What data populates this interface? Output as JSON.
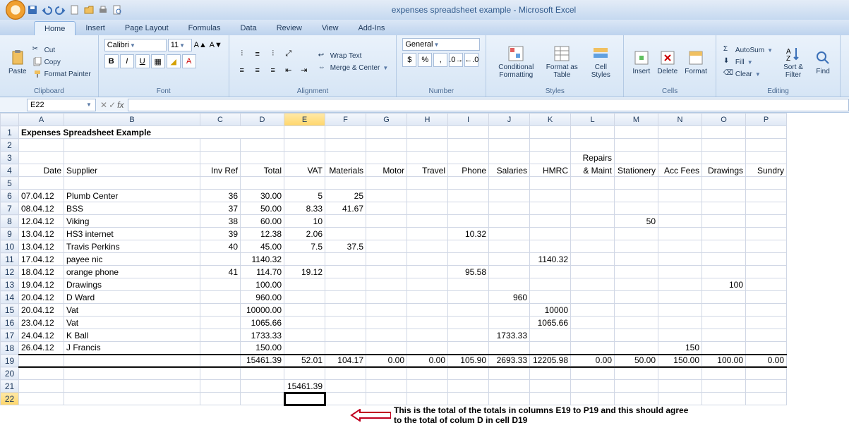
{
  "window": {
    "title": "expenses spreadsheet example - Microsoft Excel"
  },
  "tabs": [
    "Home",
    "Insert",
    "Page Layout",
    "Formulas",
    "Data",
    "Review",
    "View",
    "Add-Ins"
  ],
  "active_tab": 0,
  "ribbon": {
    "clipboard": {
      "paste": "Paste",
      "cut": "Cut",
      "copy": "Copy",
      "fp": "Format Painter",
      "label": "Clipboard"
    },
    "font": {
      "name": "Calibri",
      "size": "11",
      "label": "Font"
    },
    "alignment": {
      "wrap": "Wrap Text",
      "merge": "Merge & Center",
      "label": "Alignment"
    },
    "number": {
      "format": "General",
      "label": "Number"
    },
    "styles": {
      "cond": "Conditional Formatting",
      "fat": "Format as Table",
      "cs": "Cell Styles",
      "label": "Styles"
    },
    "cells": {
      "ins": "Insert",
      "del": "Delete",
      "fmt": "Format",
      "label": "Cells"
    },
    "editing": {
      "autosum": "AutoSum",
      "fill": "Fill",
      "clear": "Clear",
      "sort": "Sort & Filter",
      "find": "Find",
      "label": "Editing"
    }
  },
  "name_box": "E22",
  "cols": [
    "A",
    "B",
    "C",
    "D",
    "E",
    "F",
    "G",
    "H",
    "I",
    "J",
    "K",
    "L",
    "M",
    "N",
    "O",
    "P"
  ],
  "widths": [
    64,
    193,
    57,
    62,
    58,
    58,
    58,
    58,
    58,
    58,
    58,
    62,
    62,
    62,
    62,
    58
  ],
  "sheet": {
    "title": "Expenses Spreadsheet Example",
    "headers_r3": {
      "L": "Repairs"
    },
    "headers_r4": [
      "Date",
      "Supplier",
      "Inv Ref",
      "Total",
      "VAT",
      "Materials",
      "Motor",
      "Travel",
      "Phone",
      "Salaries",
      "HMRC",
      "& Maint",
      "Stationery",
      "Acc Fees",
      "Drawings",
      "Sundry"
    ],
    "rows": [
      {
        "n": 6,
        "d": [
          "07.04.12",
          "Plumb Center",
          "36",
          "30.00",
          "5",
          "25",
          "",
          "",
          "",
          "",
          "",
          "",
          "",
          "",
          "",
          ""
        ]
      },
      {
        "n": 7,
        "d": [
          "08.04.12",
          "BSS",
          "37",
          "50.00",
          "8.33",
          "41.67",
          "",
          "",
          "",
          "",
          "",
          "",
          "",
          "",
          "",
          ""
        ]
      },
      {
        "n": 8,
        "d": [
          "12.04.12",
          "Viking",
          "38",
          "60.00",
          "10",
          "",
          "",
          "",
          "",
          "",
          "",
          "",
          "50",
          "",
          "",
          ""
        ]
      },
      {
        "n": 9,
        "d": [
          "13.04.12",
          "HS3 internet",
          "39",
          "12.38",
          "2.06",
          "",
          "",
          "",
          "10.32",
          "",
          "",
          "",
          "",
          "",
          "",
          ""
        ]
      },
      {
        "n": 10,
        "d": [
          "13.04.12",
          "Travis Perkins",
          "40",
          "45.00",
          "7.5",
          "37.5",
          "",
          "",
          "",
          "",
          "",
          "",
          "",
          "",
          "",
          ""
        ]
      },
      {
        "n": 11,
        "d": [
          "17.04.12",
          "payee nic",
          "",
          "1140.32",
          "",
          "",
          "",
          "",
          "",
          "",
          "1140.32",
          "",
          "",
          "",
          "",
          ""
        ]
      },
      {
        "n": 12,
        "d": [
          "18.04.12",
          "orange phone",
          "41",
          "114.70",
          "19.12",
          "",
          "",
          "",
          "95.58",
          "",
          "",
          "",
          "",
          "",
          "",
          ""
        ]
      },
      {
        "n": 13,
        "d": [
          "19.04.12",
          "Drawings",
          "",
          "100.00",
          "",
          "",
          "",
          "",
          "",
          "",
          "",
          "",
          "",
          "",
          "100",
          ""
        ]
      },
      {
        "n": 14,
        "d": [
          "20.04.12",
          "D Ward",
          "",
          "960.00",
          "",
          "",
          "",
          "",
          "",
          "960",
          "",
          "",
          "",
          "",
          "",
          ""
        ]
      },
      {
        "n": 15,
        "d": [
          "20.04.12",
          "Vat",
          "",
          "10000.00",
          "",
          "",
          "",
          "",
          "",
          "",
          "10000",
          "",
          "",
          "",
          "",
          ""
        ]
      },
      {
        "n": 16,
        "d": [
          "23.04.12",
          "Vat",
          "",
          "1065.66",
          "",
          "",
          "",
          "",
          "",
          "",
          "1065.66",
          "",
          "",
          "",
          "",
          ""
        ]
      },
      {
        "n": 17,
        "d": [
          "24.04.12",
          "K Ball",
          "",
          "1733.33",
          "",
          "",
          "",
          "",
          "",
          "1733.33",
          "",
          "",
          "",
          "",
          "",
          ""
        ]
      },
      {
        "n": 18,
        "d": [
          "26.04.12",
          "J Francis",
          "",
          "150.00",
          "",
          "",
          "",
          "",
          "",
          "",
          "",
          "",
          "",
          "150",
          "",
          ""
        ]
      }
    ],
    "totals": {
      "n": 19,
      "d": [
        "",
        "",
        "",
        "15461.39",
        "52.01",
        "104.17",
        "0.00",
        "0.00",
        "105.90",
        "2693.33",
        "12205.98",
        "0.00",
        "50.00",
        "150.00",
        "100.00",
        "0.00"
      ]
    },
    "check": {
      "n": 21,
      "col": 4,
      "val": "15461.39"
    }
  },
  "annotation": "This is the total of the totals in columns E19 to P19 and this should agree to the total of colum D in cell D19",
  "chart_data": {
    "type": "table",
    "title": "Expenses Spreadsheet Example",
    "columns": [
      "Date",
      "Supplier",
      "Inv Ref",
      "Total",
      "VAT",
      "Materials",
      "Motor",
      "Travel",
      "Phone",
      "Salaries",
      "HMRC",
      "Repairs & Maint",
      "Stationery",
      "Acc Fees",
      "Drawings",
      "Sundry"
    ],
    "rows": [
      [
        "07.04.12",
        "Plumb Center",
        36,
        30.0,
        5,
        25,
        null,
        null,
        null,
        null,
        null,
        null,
        null,
        null,
        null,
        null
      ],
      [
        "08.04.12",
        "BSS",
        37,
        50.0,
        8.33,
        41.67,
        null,
        null,
        null,
        null,
        null,
        null,
        null,
        null,
        null,
        null
      ],
      [
        "12.04.12",
        "Viking",
        38,
        60.0,
        10,
        null,
        null,
        null,
        null,
        null,
        null,
        null,
        50,
        null,
        null,
        null
      ],
      [
        "13.04.12",
        "HS3 internet",
        39,
        12.38,
        2.06,
        null,
        null,
        null,
        10.32,
        null,
        null,
        null,
        null,
        null,
        null,
        null
      ],
      [
        "13.04.12",
        "Travis Perkins",
        40,
        45.0,
        7.5,
        37.5,
        null,
        null,
        null,
        null,
        null,
        null,
        null,
        null,
        null,
        null
      ],
      [
        "17.04.12",
        "payee nic",
        null,
        1140.32,
        null,
        null,
        null,
        null,
        null,
        null,
        1140.32,
        null,
        null,
        null,
        null,
        null
      ],
      [
        "18.04.12",
        "orange phone",
        41,
        114.7,
        19.12,
        null,
        null,
        null,
        95.58,
        null,
        null,
        null,
        null,
        null,
        null,
        null
      ],
      [
        "19.04.12",
        "Drawings",
        null,
        100.0,
        null,
        null,
        null,
        null,
        null,
        null,
        null,
        null,
        null,
        null,
        100,
        null
      ],
      [
        "20.04.12",
        "D Ward",
        null,
        960.0,
        null,
        null,
        null,
        null,
        null,
        960,
        null,
        null,
        null,
        null,
        null,
        null
      ],
      [
        "20.04.12",
        "Vat",
        null,
        10000.0,
        null,
        null,
        null,
        null,
        null,
        null,
        10000,
        null,
        null,
        null,
        null,
        null
      ],
      [
        "23.04.12",
        "Vat",
        null,
        1065.66,
        null,
        null,
        null,
        null,
        null,
        null,
        1065.66,
        null,
        null,
        null,
        null,
        null
      ],
      [
        "24.04.12",
        "K Ball",
        null,
        1733.33,
        null,
        null,
        null,
        null,
        null,
        1733.33,
        null,
        null,
        null,
        null,
        null,
        null
      ],
      [
        "26.04.12",
        "J Francis",
        null,
        150.0,
        null,
        null,
        null,
        null,
        null,
        null,
        null,
        null,
        null,
        150,
        null,
        null
      ]
    ],
    "totals": [
      null,
      null,
      null,
      15461.39,
      52.01,
      104.17,
      0.0,
      0.0,
      105.9,
      2693.33,
      12205.98,
      0.0,
      50.0,
      150.0,
      100.0,
      0.0
    ],
    "grand_total_check": 15461.39
  }
}
